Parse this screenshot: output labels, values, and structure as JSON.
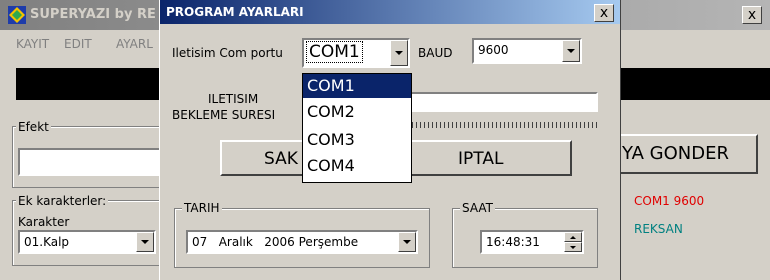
{
  "main_window": {
    "title": "SUPERYAZI by RE",
    "close_label": "x",
    "menu": [
      "KAYIT",
      "EDIT",
      "AYARL"
    ],
    "efekt_label": "Efekt",
    "ek_karakterler_label": "Ek karakterler:",
    "karakter_label": "Karakter",
    "karakter_value": "01.Kalp",
    "send_button_label": "YA GONDER",
    "status_port": "COM1 9600",
    "status_company": "REKSAN",
    "status_port_color": "#e00000",
    "status_company_color": "#008080"
  },
  "dialog": {
    "title": "PROGRAM AYARLARI",
    "close_label": "x",
    "com_port_label": "Iletisim Com portu",
    "com_port_value": "COM1",
    "baud_label": "BAUD",
    "baud_value": "9600",
    "wait_label_line1": "ILETISIM",
    "wait_label_line2": "BEKLEME SURESI",
    "save_button_label": "SAK",
    "cancel_button_label": "IPTAL",
    "tarih_label": "TARIH",
    "tarih_value": "07   Aralık   2006 Perşembe",
    "saat_label": "SAAT",
    "saat_value": "16:48:31",
    "com_options": [
      "COM1",
      "COM2",
      "COM3",
      "COM4"
    ],
    "accent_color": "#0a246a"
  }
}
